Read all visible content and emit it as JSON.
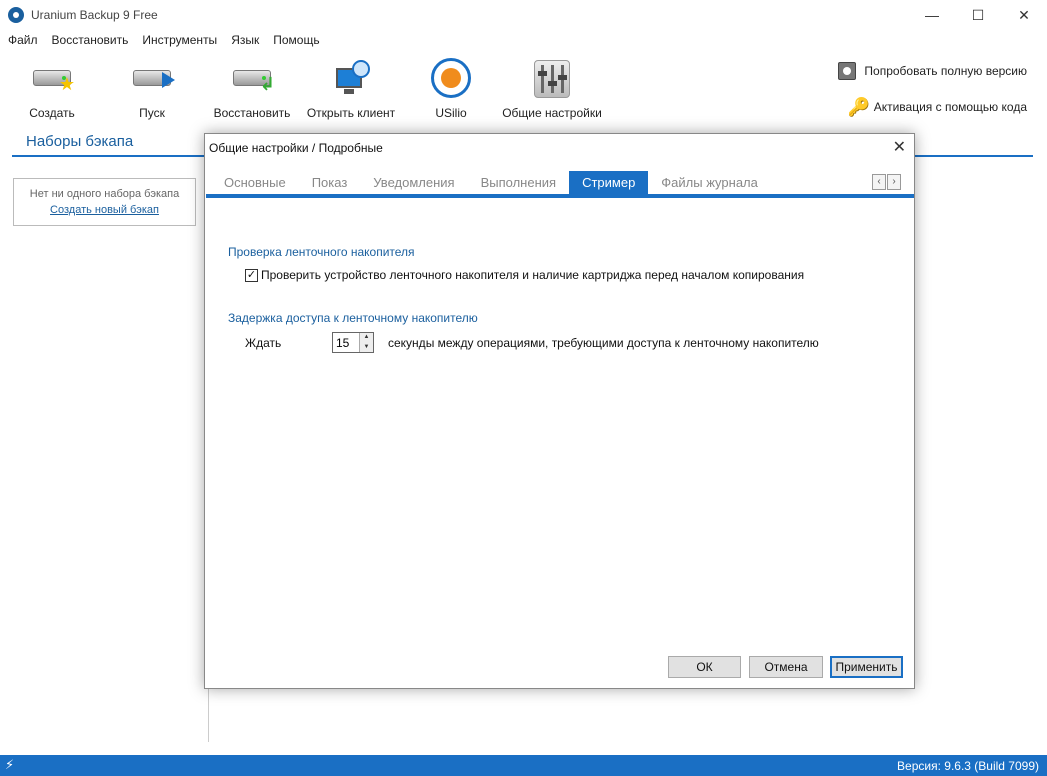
{
  "window": {
    "title": "Uranium Backup 9 Free",
    "minimize": "—",
    "maximize": "☐",
    "close": "✕"
  },
  "menu": [
    "Файл",
    "Восстановить",
    "Инструменты",
    "Язык",
    "Помощь"
  ],
  "toolbar": {
    "create": "Создать",
    "start": "Пуск",
    "restore": "Восстановить",
    "open_client": "Открыть клиент",
    "usilio": "USilio",
    "general_settings": "Общие настройки",
    "try_full": "Попробовать полную версию",
    "activate": "Активация с помощью кода"
  },
  "left": {
    "title": "Наборы бэкапа",
    "empty_text": "Нет ни одного набора бэкапа",
    "create_link": "Создать новый бэкап"
  },
  "dialog": {
    "title": "Общие настройки / Подробные",
    "close": "✕",
    "tabs": [
      "Основные",
      "Показ",
      "Уведомления",
      "Выполнения",
      "Стример",
      "Файлы журнала"
    ],
    "active_tab": "Стример",
    "tab_prev": "‹",
    "tab_next": "›",
    "section_tape_check": "Проверка ленточного накопителя",
    "check_tape_label": "Проверить устройство ленточного накопителя и наличие картриджа перед началом копирования",
    "check_tape_checked": true,
    "check_mark": "✓",
    "section_delay": "Задержка доступа к ленточному накопителю",
    "wait_label": "Ждать",
    "wait_value": "15",
    "wait_after": "секунды между операциями, требующими доступа к ленточному накопителю",
    "spin_up": "▲",
    "spin_down": "▼",
    "ok": "ОК",
    "cancel": "Отмена",
    "apply": "Применить"
  },
  "status": {
    "version": "Версия: 9.6.3 (Build 7099)",
    "icon": "plug-icon"
  },
  "colors": {
    "accent": "#1a6fc4",
    "heading": "#1a5f9e"
  }
}
